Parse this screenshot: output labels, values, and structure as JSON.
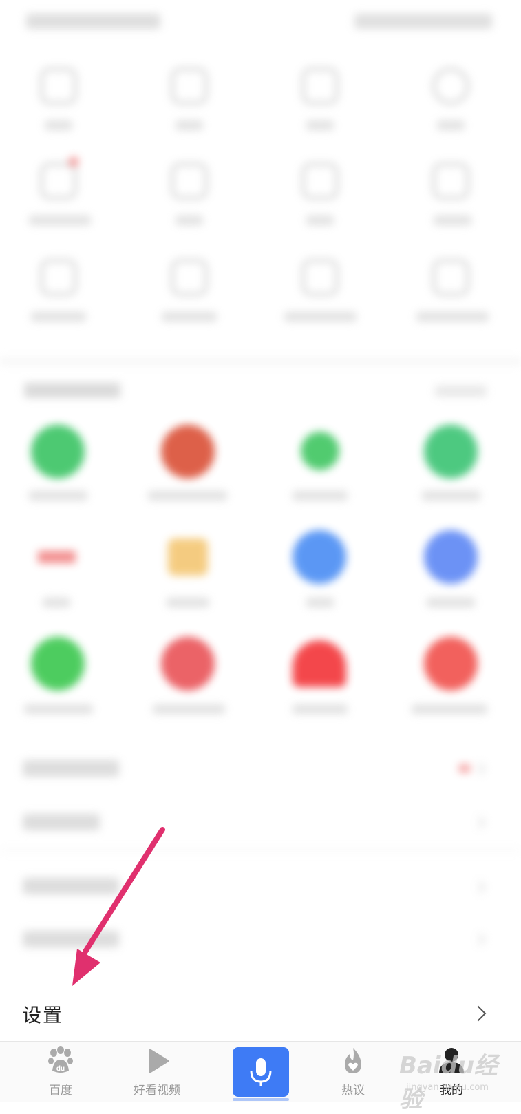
{
  "settings_row": {
    "label": "设置"
  },
  "bottom_nav": {
    "items": [
      {
        "label": "百度",
        "icon": "paw-icon",
        "logo_text": "du"
      },
      {
        "label": "好看视频",
        "icon": "play-icon"
      },
      {
        "label": "",
        "icon": "microphone-icon"
      },
      {
        "label": "热议",
        "icon": "flame-icon"
      },
      {
        "label": "我的",
        "icon": "user-icon"
      }
    ]
  },
  "annotation": {
    "arrow_color": "#e0306e"
  },
  "watermark": {
    "text": "Baidu经验",
    "sub": "jingyan.baidu.com"
  },
  "colors": {
    "mic_button": "#3e7bf5",
    "nav_label": "#999999"
  }
}
